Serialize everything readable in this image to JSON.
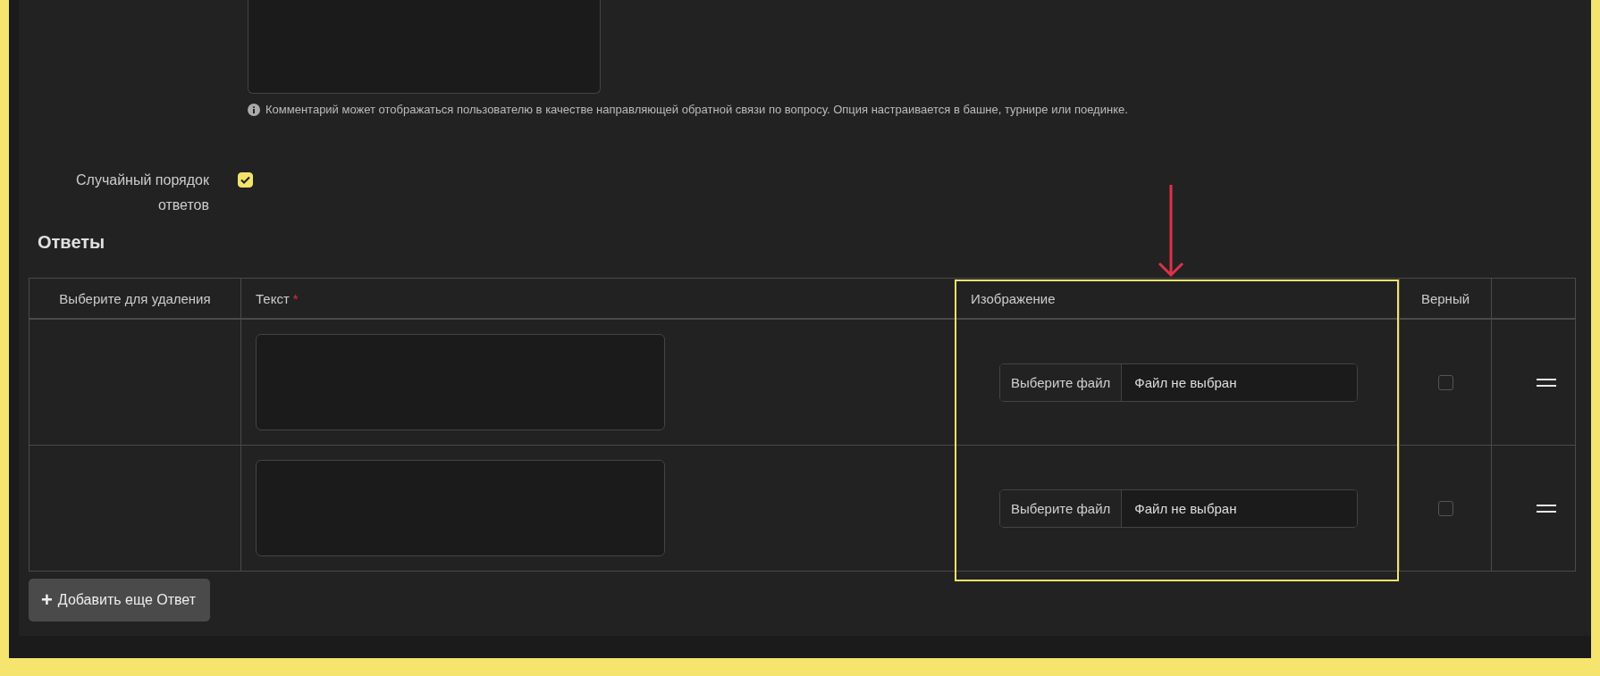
{
  "comment_hint": "Комментарий может отображаться пользователю в качестве направляющей обратной связи по вопросу. Опция настраивается в башне, турнире или поединке.",
  "shuffle": {
    "label": "Случайный порядок ответов",
    "checked": true
  },
  "answers": {
    "title": "Ответы",
    "columns": [
      {
        "label": "Выберите для удаления"
      },
      {
        "label": "Текст",
        "required_mark": "*"
      },
      {
        "label": "Изображение"
      },
      {
        "label": "Верный"
      }
    ],
    "rows": [
      {
        "file_button": "Выберите файл",
        "file_status": "Файл не выбран",
        "correct": false
      },
      {
        "file_button": "Выберите файл",
        "file_status": "Файл не выбран",
        "correct": false
      }
    ],
    "add_button": {
      "icon": "+",
      "label": "Добавить еще Ответ"
    }
  }
}
